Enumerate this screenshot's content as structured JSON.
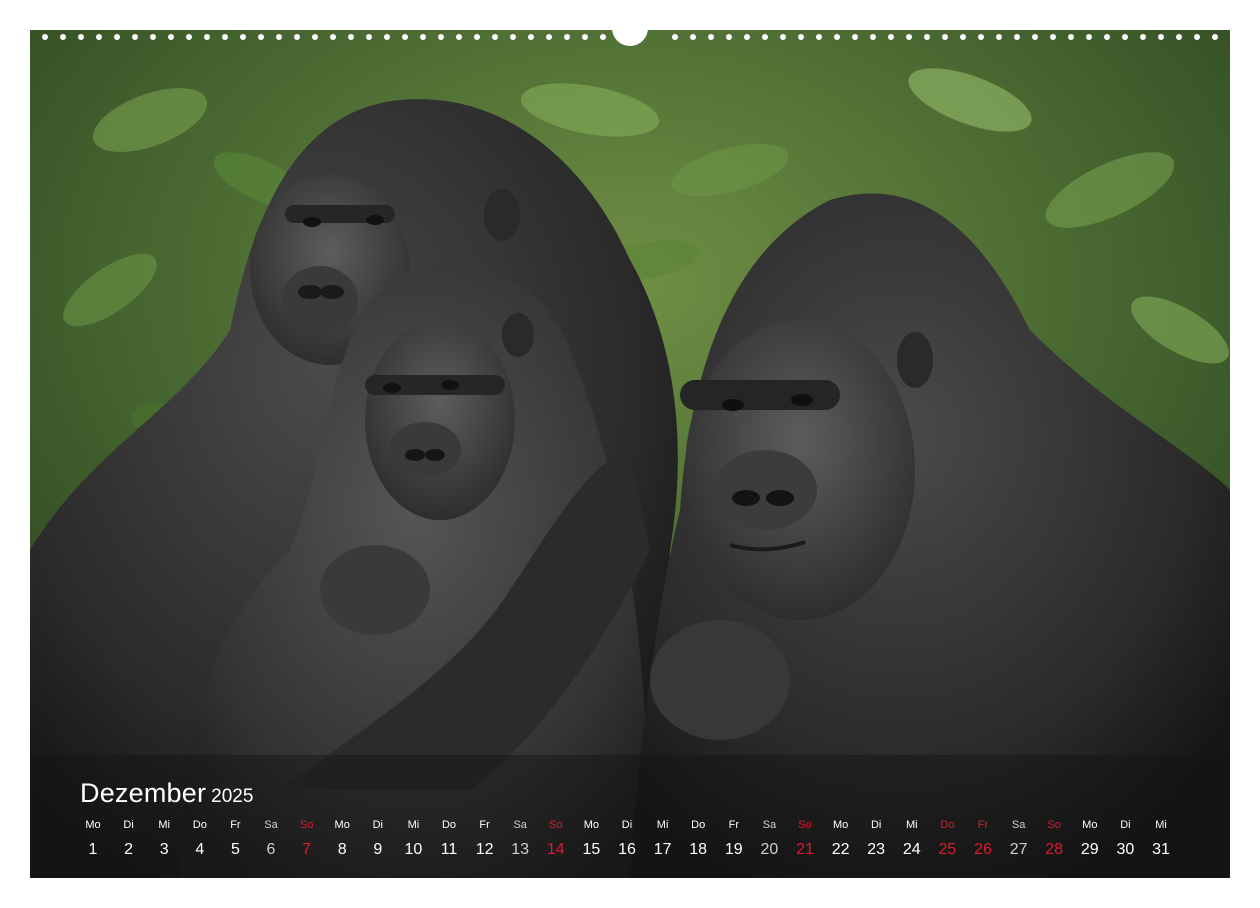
{
  "calendar": {
    "month": "Dezember",
    "year": "2025",
    "days": [
      {
        "wd": "Mo",
        "d": "1",
        "type": "normal"
      },
      {
        "wd": "Di",
        "d": "2",
        "type": "normal"
      },
      {
        "wd": "Mi",
        "d": "3",
        "type": "normal"
      },
      {
        "wd": "Do",
        "d": "4",
        "type": "normal"
      },
      {
        "wd": "Fr",
        "d": "5",
        "type": "normal"
      },
      {
        "wd": "Sa",
        "d": "6",
        "type": "sat"
      },
      {
        "wd": "So",
        "d": "7",
        "type": "hol"
      },
      {
        "wd": "Mo",
        "d": "8",
        "type": "normal"
      },
      {
        "wd": "Di",
        "d": "9",
        "type": "normal"
      },
      {
        "wd": "Mi",
        "d": "10",
        "type": "normal"
      },
      {
        "wd": "Do",
        "d": "11",
        "type": "normal"
      },
      {
        "wd": "Fr",
        "d": "12",
        "type": "normal"
      },
      {
        "wd": "Sa",
        "d": "13",
        "type": "sat"
      },
      {
        "wd": "So",
        "d": "14",
        "type": "hol"
      },
      {
        "wd": "Mo",
        "d": "15",
        "type": "normal"
      },
      {
        "wd": "Di",
        "d": "16",
        "type": "normal"
      },
      {
        "wd": "Mi",
        "d": "17",
        "type": "normal"
      },
      {
        "wd": "Do",
        "d": "18",
        "type": "normal"
      },
      {
        "wd": "Fr",
        "d": "19",
        "type": "normal"
      },
      {
        "wd": "Sa",
        "d": "20",
        "type": "sat"
      },
      {
        "wd": "So",
        "d": "21",
        "type": "hol"
      },
      {
        "wd": "Mo",
        "d": "22",
        "type": "normal"
      },
      {
        "wd": "Di",
        "d": "23",
        "type": "normal"
      },
      {
        "wd": "Mi",
        "d": "24",
        "type": "normal"
      },
      {
        "wd": "Do",
        "d": "25",
        "type": "hol"
      },
      {
        "wd": "Fr",
        "d": "26",
        "type": "hol"
      },
      {
        "wd": "Sa",
        "d": "27",
        "type": "sat"
      },
      {
        "wd": "So",
        "d": "28",
        "type": "hol"
      },
      {
        "wd": "Mo",
        "d": "29",
        "type": "normal"
      },
      {
        "wd": "Di",
        "d": "30",
        "type": "normal"
      },
      {
        "wd": "Mi",
        "d": "31",
        "type": "normal"
      }
    ]
  },
  "colors": {
    "holiday": "#e0192d",
    "saturday": "#cfcfcf",
    "text": "#ffffff",
    "band": "rgba(20,20,20,0.45)"
  },
  "photo": {
    "subject_icon": "gorilla-group-photo"
  }
}
